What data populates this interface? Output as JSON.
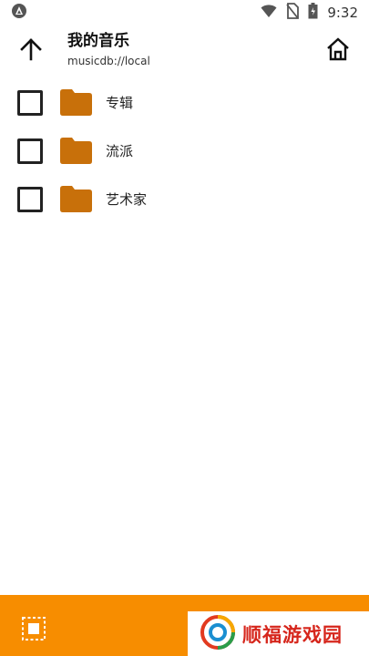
{
  "status_bar": {
    "time": "9:32",
    "icons": [
      "android-notify-icon",
      "wifi-icon",
      "no-sim-icon",
      "battery-icon"
    ]
  },
  "header": {
    "title": "我的音乐",
    "subtitle": "musicdb://local",
    "back_icon": "arrow-up-icon",
    "home_icon": "home-icon"
  },
  "list": {
    "items": [
      {
        "label": "专辑",
        "icon": "folder-icon",
        "checked": false
      },
      {
        "label": "流派",
        "icon": "folder-icon",
        "checked": false
      },
      {
        "label": "艺术家",
        "icon": "folder-icon",
        "checked": false
      }
    ]
  },
  "bottom_bar": {
    "select_icon": "select-all-icon"
  },
  "watermark": {
    "text": "顺福游戏园"
  },
  "colors": {
    "accent": "#f78d00",
    "folder": "#c8700a",
    "watermark_text": "#d6261c"
  }
}
